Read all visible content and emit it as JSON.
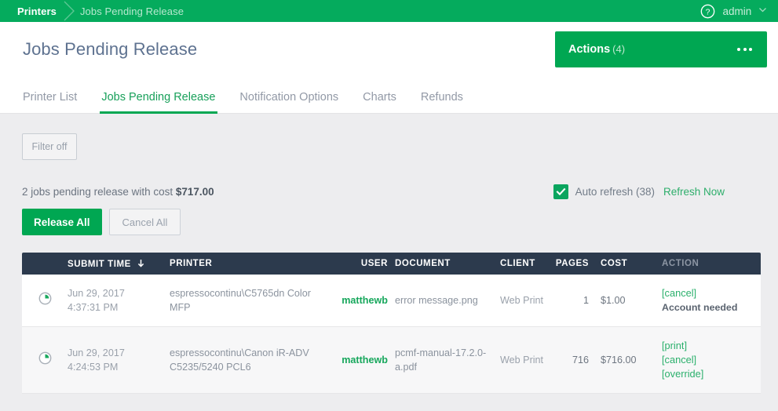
{
  "topbar": {
    "breadcrumb_root": "Printers",
    "breadcrumb_current": "Jobs Pending Release",
    "help_icon": "help-circle-icon",
    "user": "admin",
    "user_chevron": "chevron-down-icon",
    "bg_color": "#05ab5d"
  },
  "header": {
    "title": "Jobs Pending Release",
    "actions_label": "Actions",
    "actions_count": "(4)",
    "overflow_icon": "ellipsis-icon",
    "accent_color": "#00a752"
  },
  "tabs": [
    {
      "label": "Printer List",
      "active": false
    },
    {
      "label": "Jobs Pending Release",
      "active": true
    },
    {
      "label": "Notification Options",
      "active": false
    },
    {
      "label": "Charts",
      "active": false
    },
    {
      "label": "Refunds",
      "active": false
    }
  ],
  "toolbar": {
    "filter_label": "Filter off"
  },
  "summary": {
    "text_prefix": "2 jobs pending release with cost ",
    "cost": "$717.00",
    "auto_refresh_label": "Auto refresh (38)",
    "refresh_now_label": "Refresh Now",
    "auto_refresh_checked": true,
    "checkbox_icon": "check-icon"
  },
  "buttons": {
    "release_all": "Release All",
    "cancel_all": "Cancel All"
  },
  "table": {
    "columns": {
      "icon": "",
      "submit_time": "SUBMIT TIME",
      "sort_icon": "arrow-down-icon",
      "printer": "PRINTER",
      "user": "USER",
      "document": "DOCUMENT",
      "client": "CLIENT",
      "pages": "PAGES",
      "cost": "COST",
      "action": "ACTION"
    },
    "rows": [
      {
        "icon": "clock-icon",
        "date": "Jun 29, 2017",
        "time": "4:37:31 PM",
        "printer": "espressocontinu\\C5765dn Color MFP",
        "user": "matthewb",
        "document": "error message.png",
        "client": "Web Print",
        "pages": "1",
        "cost": "$1.00",
        "actions": [
          "[cancel]"
        ],
        "note": "Account needed"
      },
      {
        "icon": "clock-icon",
        "date": "Jun 29, 2017",
        "time": "4:24:53 PM",
        "printer": "espressocontinu\\Canon iR-ADV C5235/5240 PCL6",
        "user": "matthewb",
        "document": "pcmf-manual-17.2.0-a.pdf",
        "client": "Web Print",
        "pages": "716",
        "cost": "$716.00",
        "actions": [
          "[print]",
          "[cancel]",
          "[override]"
        ],
        "note": ""
      }
    ]
  }
}
